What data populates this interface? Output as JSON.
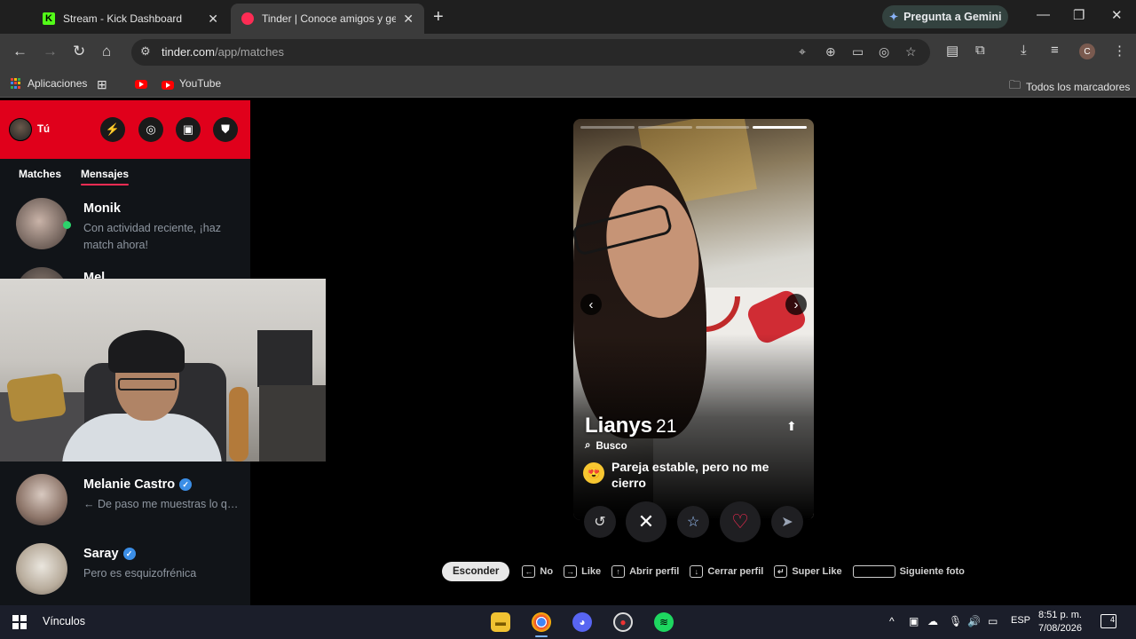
{
  "browser": {
    "tabs": [
      {
        "title": "Stream - Kick Dashboard"
      },
      {
        "title": "Tinder | Conoce amigos y gente"
      }
    ],
    "gemini_label": "Pregunta a Gemini",
    "url_host": "tinder.com",
    "url_path": "/app/matches",
    "profile_initial": "C",
    "bookmarks": {
      "apps": "Aplicaciones",
      "youtube": "YouTube",
      "all_bookmarks": "Todos los marcadores"
    }
  },
  "sidebar": {
    "me_label": "Tú",
    "tabs": {
      "matches": "Matches",
      "messages": "Mensajes"
    },
    "conversations": [
      {
        "name": "Monik",
        "preview": "Con actividad reciente, ¡haz match ahora!",
        "online": true
      },
      {
        "name": "Mel",
        "preview": ""
      },
      {
        "name": "Melanie Castro",
        "preview": "← De paso me muestras lo que...",
        "verified": true
      },
      {
        "name": "Saray",
        "preview": "Pero es esquizofrénica",
        "verified": true
      }
    ]
  },
  "profile": {
    "name": "Lianys",
    "age": "21",
    "looking_label": "Busco",
    "goal": "Pareja estable, pero no me cierro",
    "photo_count": 4,
    "current_photo": 4
  },
  "hints": {
    "hide": "Esconder",
    "no": "No",
    "like": "Like",
    "open_profile": "Abrir perfil",
    "close_profile": "Cerrar perfil",
    "super_like": "Super Like",
    "next_photo": "Siguiente foto"
  },
  "taskbar": {
    "search_label": "Vínculos",
    "language": "ESP",
    "time": "8:51 p. m.",
    "date": "7/08/2026",
    "notifications": "4"
  },
  "colors": {
    "tinder_red": "#e0001b",
    "accent_pink": "#fd2c54",
    "online_green": "#2cd46b"
  }
}
